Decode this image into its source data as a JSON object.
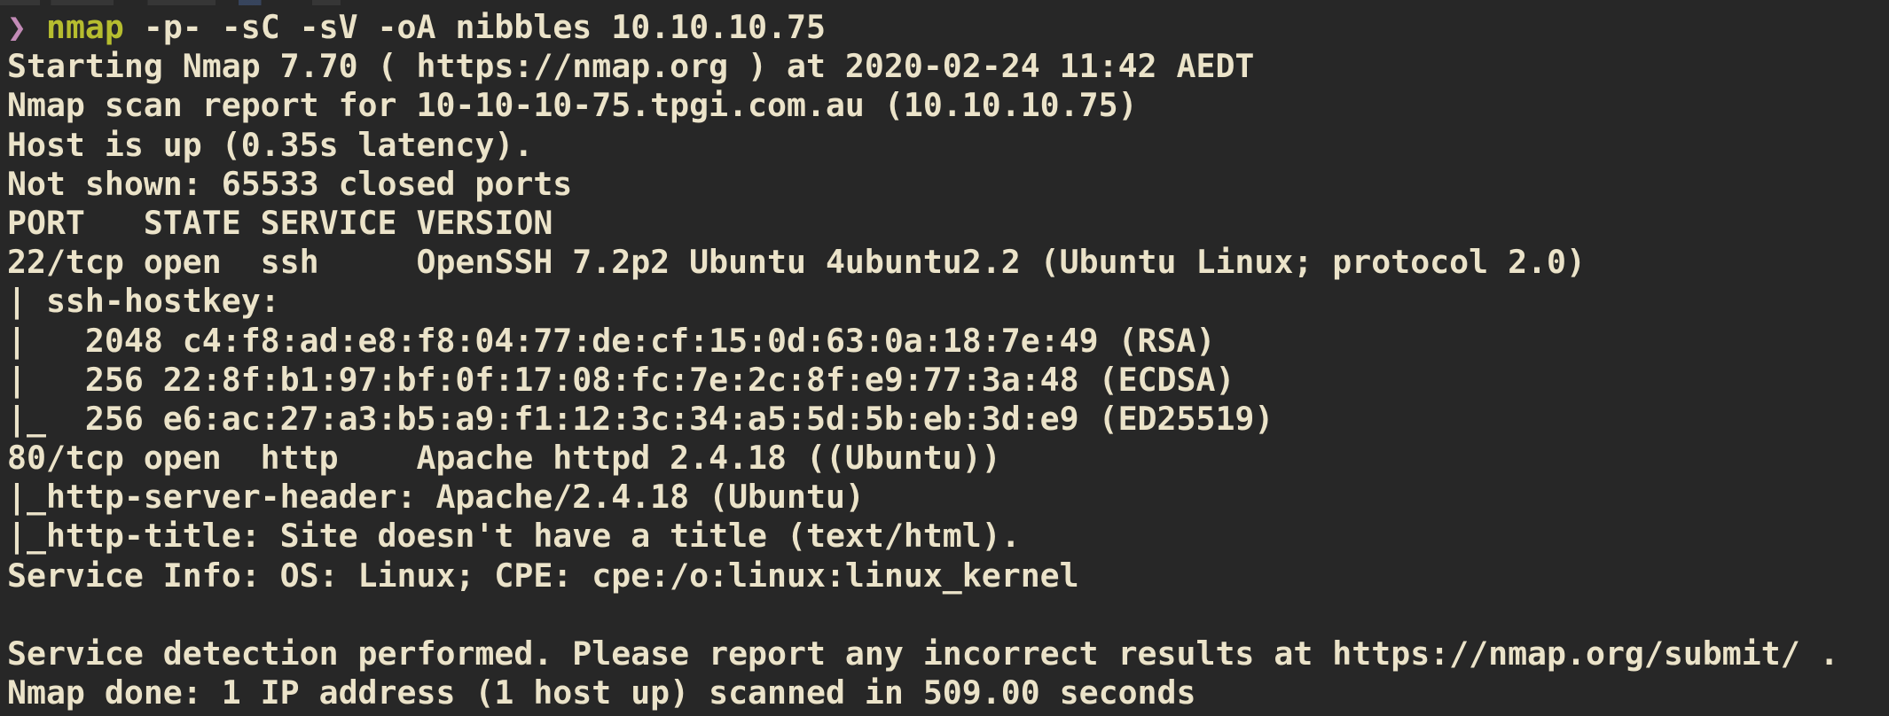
{
  "terminal": {
    "prompt": {
      "symbol": "❯",
      "command": "nmap",
      "args": "-p- -sC -sV -oA nibbles 10.10.10.75"
    },
    "output_lines": [
      "Starting Nmap 7.70 ( https://nmap.org ) at 2020-02-24 11:42 AEDT",
      "Nmap scan report for 10-10-10-75.tpgi.com.au (10.10.10.75)",
      "Host is up (0.35s latency).",
      "Not shown: 65533 closed ports",
      "PORT   STATE SERVICE VERSION",
      "22/tcp open  ssh     OpenSSH 7.2p2 Ubuntu 4ubuntu2.2 (Ubuntu Linux; protocol 2.0)",
      "| ssh-hostkey: ",
      "|   2048 c4:f8:ad:e8:f8:04:77:de:cf:15:0d:63:0a:18:7e:49 (RSA)",
      "|   256 22:8f:b1:97:bf:0f:17:08:fc:7e:2c:8f:e9:77:3a:48 (ECDSA)",
      "|_  256 e6:ac:27:a3:b5:a9:f1:12:3c:34:a5:5d:5b:eb:3d:e9 (ED25519)",
      "80/tcp open  http    Apache httpd 2.4.18 ((Ubuntu))",
      "|_http-server-header: Apache/2.4.18 (Ubuntu)",
      "|_http-title: Site doesn't have a title (text/html).",
      "Service Info: OS: Linux; CPE: cpe:/o:linux:linux_kernel",
      "",
      "Service detection performed. Please report any incorrect results at https://nmap.org/submit/ .",
      "Nmap done: 1 IP address (1 host up) scanned in 509.00 seconds"
    ]
  },
  "colors": {
    "background": "#272727",
    "text": "#ebe3c9",
    "prompt_symbol": "#c38bb7",
    "command": "#b6bd2f"
  }
}
